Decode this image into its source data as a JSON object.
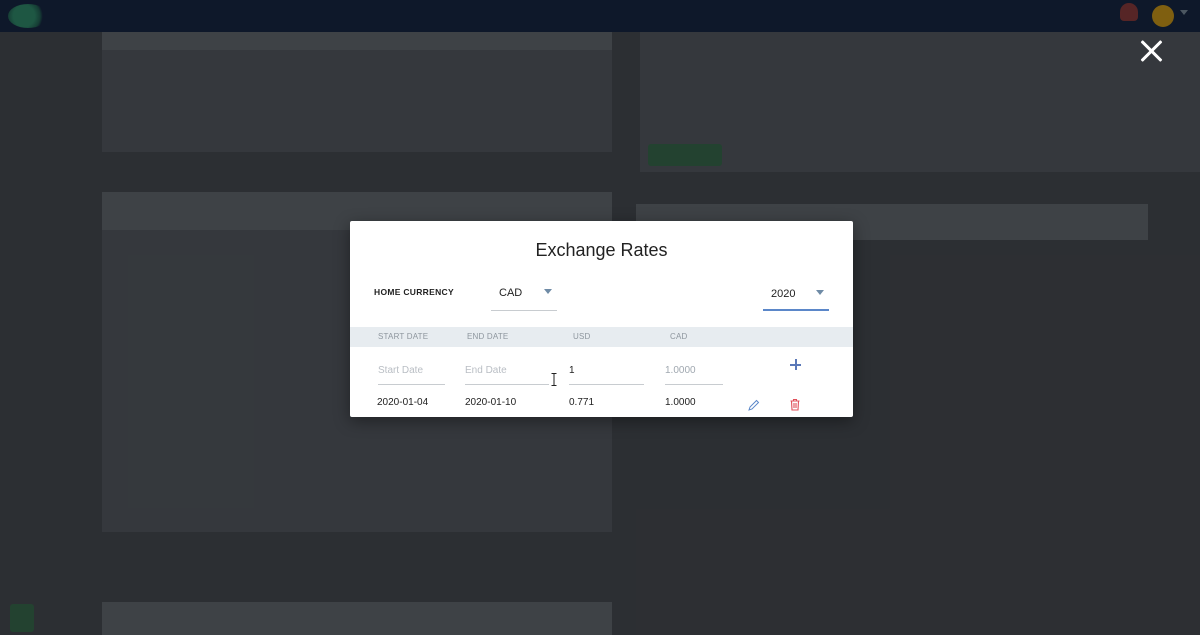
{
  "modal": {
    "title": "Exchange Rates",
    "home_currency_label": "HOME CURRENCY",
    "home_currency_value": "CAD",
    "year_value": "2020",
    "columns": [
      "START DATE",
      "END DATE",
      "USD",
      "CAD"
    ],
    "new_row": {
      "start_placeholder": "Start Date",
      "end_placeholder": "End Date",
      "usd_value": "1",
      "cad_value": "1.0000"
    },
    "rows": [
      {
        "start": "2020-01-04",
        "end": "2020-01-10",
        "usd": "0.771",
        "cad": "1.0000"
      }
    ]
  },
  "icons": {
    "close": "close-icon",
    "add": "plus-icon",
    "edit": "pencil-icon",
    "delete": "trash-icon"
  },
  "colors": {
    "topbar": "#0c1a33",
    "accent": "#5b87c9",
    "delete": "#e0505a",
    "table_header_bg": "#e7ecf0"
  }
}
